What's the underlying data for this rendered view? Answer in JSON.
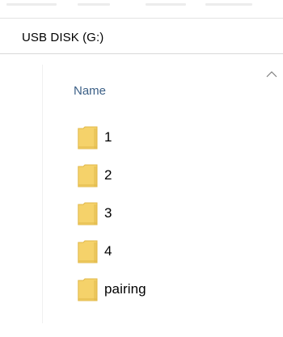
{
  "location": {
    "path": "USB DISK (G:)"
  },
  "file_list": {
    "column": {
      "name_label": "Name",
      "sort_direction": "ascending"
    },
    "items": [
      {
        "label": "1",
        "icon": "folder-icon"
      },
      {
        "label": "2",
        "icon": "folder-icon"
      },
      {
        "label": "3",
        "icon": "folder-icon"
      },
      {
        "label": "4",
        "icon": "folder-icon"
      },
      {
        "label": "pairing",
        "icon": "folder-icon"
      }
    ]
  },
  "colors": {
    "folder_fill": "#f5d26a",
    "folder_dark": "#e1b84a",
    "header_text": "#3b5f86"
  }
}
